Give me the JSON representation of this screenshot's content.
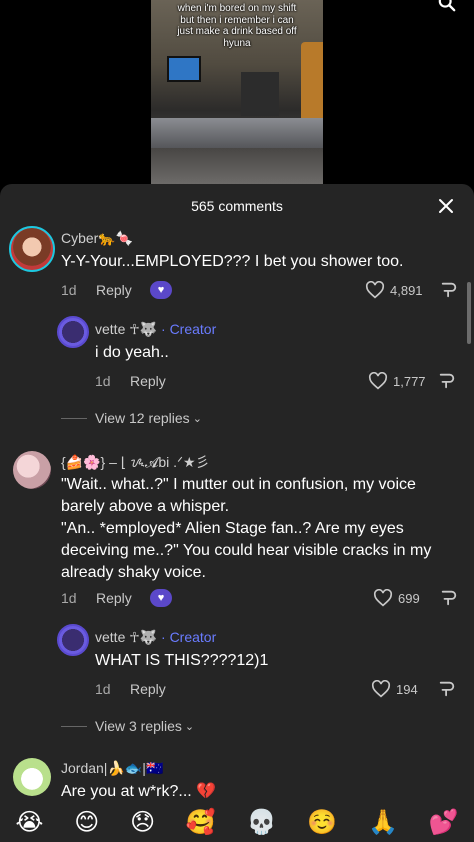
{
  "video": {
    "caption_lines": [
      "when i'm bored on my shift",
      "but then i remember i can",
      "just make a drink based off",
      "hyuna"
    ]
  },
  "sheet": {
    "title": "565 comments"
  },
  "comments": [
    {
      "username": "Cyber🐆🍬",
      "text": "Y-Y-Your...EMPLOYED??? I bet you shower too.",
      "time": "1d",
      "reply_label": "Reply",
      "likes": "4,891",
      "replies": [
        {
          "username": "vette ☥🐺",
          "creator_label": "· Creator",
          "text": "i do yeah..",
          "time": "1d",
          "reply_label": "Reply",
          "likes": "1,777"
        }
      ],
      "view_replies": "View 12 replies"
    },
    {
      "username": "{🍰🌸} – ⌊ ᝰ𝓐bi  .ᐟ★彡",
      "text_lines": [
        "\"Wait.. what..?\" I mutter out in confusion, my voice",
        "barely above a whisper.",
        "\"An.. *employed* Alien Stage fan..? Are my eyes",
        "deceiving me..?\" You could hear visible cracks in my",
        "already shaky voice."
      ],
      "time": "1d",
      "reply_label": "Reply",
      "likes": "699",
      "replies": [
        {
          "username": "vette ☥🐺",
          "creator_label": "· Creator",
          "text": "WHAT IS THIS????12)1",
          "time": "1d",
          "reply_label": "Reply",
          "likes": "194"
        }
      ],
      "view_replies": "View 3 replies"
    },
    {
      "username": "Jordan|🍌🐟|🇦🇺",
      "text": "Are you at w*rk?... 💔"
    }
  ],
  "emoji_bar": [
    "😭",
    "😊",
    "😞",
    "🥰",
    "💀",
    "☺️",
    "🙏",
    "💕"
  ]
}
